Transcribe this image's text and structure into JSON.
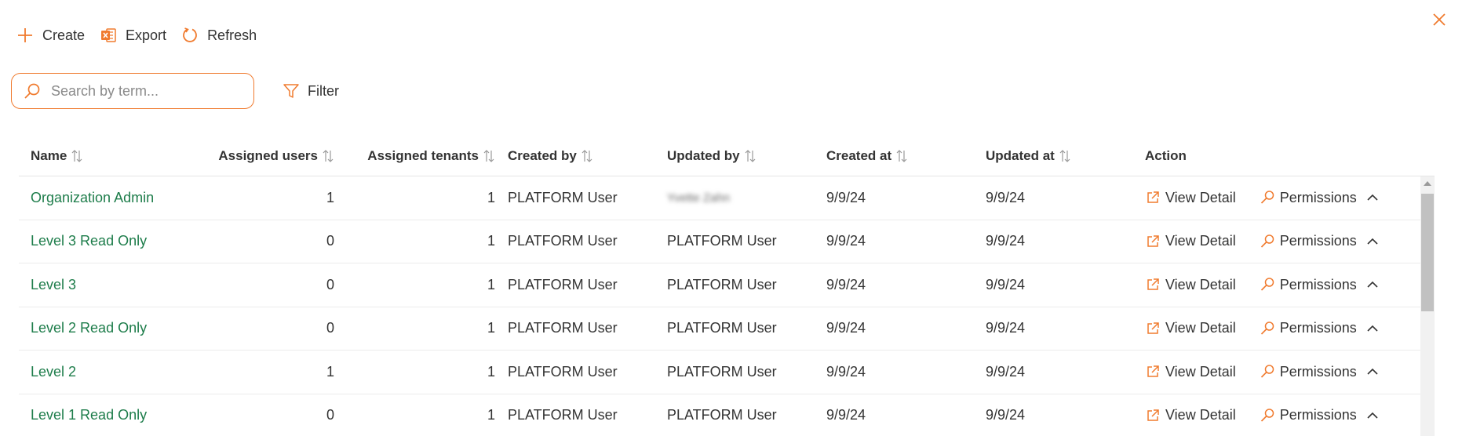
{
  "toolbar": {
    "create_label": "Create",
    "export_label": "Export",
    "refresh_label": "Refresh"
  },
  "search": {
    "placeholder": "Search by term...",
    "value": ""
  },
  "filter": {
    "label": "Filter"
  },
  "table": {
    "headers": {
      "name": "Name",
      "assigned_users": "Assigned users",
      "assigned_tenants": "Assigned tenants",
      "created_by": "Created by",
      "updated_by": "Updated by",
      "created_at": "Created at",
      "updated_at": "Updated at",
      "action": "Action"
    },
    "rows": [
      {
        "name": "Organization Admin",
        "assigned_users": "1",
        "assigned_tenants": "1",
        "created_by": "PLATFORM User",
        "updated_by": "Yvette Zahn",
        "updated_by_blurred": true,
        "created_at": "9/9/24",
        "updated_at": "9/9/24"
      },
      {
        "name": "Level 3 Read Only",
        "assigned_users": "0",
        "assigned_tenants": "1",
        "created_by": "PLATFORM User",
        "updated_by": "PLATFORM User",
        "created_at": "9/9/24",
        "updated_at": "9/9/24"
      },
      {
        "name": "Level 3",
        "assigned_users": "0",
        "assigned_tenants": "1",
        "created_by": "PLATFORM User",
        "updated_by": "PLATFORM User",
        "created_at": "9/9/24",
        "updated_at": "9/9/24"
      },
      {
        "name": "Level 2 Read Only",
        "assigned_users": "0",
        "assigned_tenants": "1",
        "created_by": "PLATFORM User",
        "updated_by": "PLATFORM User",
        "created_at": "9/9/24",
        "updated_at": "9/9/24"
      },
      {
        "name": "Level 2",
        "assigned_users": "1",
        "assigned_tenants": "1",
        "created_by": "PLATFORM User",
        "updated_by": "PLATFORM User",
        "created_at": "9/9/24",
        "updated_at": "9/9/24"
      },
      {
        "name": "Level 1 Read Only",
        "assigned_users": "0",
        "assigned_tenants": "1",
        "created_by": "PLATFORM User",
        "updated_by": "PLATFORM User",
        "created_at": "9/9/24",
        "updated_at": "9/9/24"
      }
    ],
    "actions": {
      "view_detail": "View Detail",
      "permissions": "Permissions"
    }
  },
  "colors": {
    "accent": "#f07b2f",
    "link_green": "#1e7d4b",
    "text": "#333333"
  },
  "icons": {
    "create": "plus-icon",
    "export": "excel-icon",
    "refresh": "refresh-icon",
    "search": "search-icon",
    "filter": "filter-icon",
    "sort": "sort-icon",
    "view_detail": "external-link-icon",
    "permissions": "key-icon",
    "expand": "chevron-up-icon",
    "close": "close-icon"
  }
}
